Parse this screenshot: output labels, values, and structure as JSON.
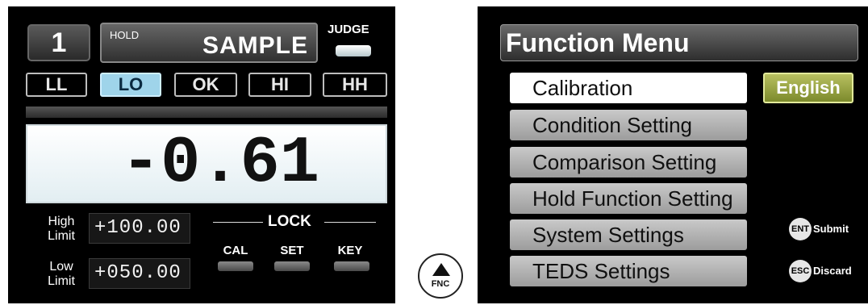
{
  "left_screen": {
    "channel": "1",
    "hold_label": "HOLD",
    "mode_label": "SAMPLE",
    "judge_label": "JUDGE",
    "judge_buttons": [
      {
        "label": "LL",
        "active": false
      },
      {
        "label": "LO",
        "active": true
      },
      {
        "label": "OK",
        "active": false
      },
      {
        "label": "HI",
        "active": false
      },
      {
        "label": "HH",
        "active": false
      }
    ],
    "measured_value": "-0.61",
    "high_limit": {
      "label_line1": "High",
      "label_line2": "Limit",
      "value": "+100.00"
    },
    "low_limit": {
      "label_line1": "Low",
      "label_line2": "Limit",
      "value": "+050.00"
    },
    "lock": {
      "title": "LOCK",
      "keys": [
        {
          "label": "CAL"
        },
        {
          "label": "SET"
        },
        {
          "label": "KEY"
        }
      ]
    }
  },
  "fnc_button": {
    "label": "FNC"
  },
  "right_screen": {
    "title": "Function Menu",
    "menu_items": [
      {
        "label": "Calibration",
        "selected": true
      },
      {
        "label": "Condition Setting",
        "selected": false
      },
      {
        "label": "Comparison Setting",
        "selected": false
      },
      {
        "label": "Hold Function Setting",
        "selected": false
      },
      {
        "label": "System Settings",
        "selected": false
      },
      {
        "label": "TEDS Settings",
        "selected": false
      }
    ],
    "language_button": "English",
    "enter_hint": {
      "key": "ENT",
      "text": "Submit"
    },
    "escape_hint": {
      "key": "ESC",
      "text": "Discard"
    }
  },
  "colors": {
    "active_judge": "#9fd4ea",
    "language_button": "#9aa63e",
    "menu_item": "#b4b4b4",
    "selected_menu_item": "#ffffff"
  }
}
